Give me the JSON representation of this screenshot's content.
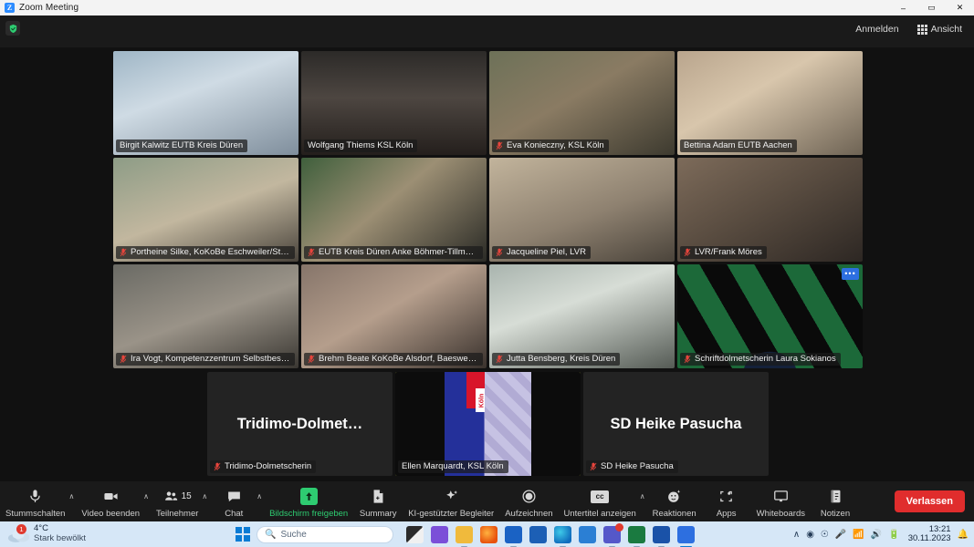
{
  "window": {
    "title": "Zoom Meeting",
    "logo_text": "Z",
    "minimize": "–",
    "maximize": "▭",
    "close": "✕"
  },
  "header": {
    "shield_icon": "security-shield-icon",
    "sign_in_label": "Anmelden",
    "view_label": "Ansicht"
  },
  "gallery": {
    "tiles": [
      {
        "name": "Birgit Kalwitz EUTB Kreis Düren",
        "muted": false,
        "speaking": false,
        "more": false,
        "bg": "linear-gradient(160deg,#9fb6c6 0%,#cfdbe4 40%,#7f8e9c 100%)"
      },
      {
        "name": "Wolfgang Thiems KSL Köln",
        "muted": false,
        "speaking": false,
        "more": false,
        "bg": "linear-gradient(180deg,#2c2a28 0%,#4d4641 45%,#241f1c 100%)"
      },
      {
        "name": "Eva Konieczny, KSL Köln",
        "muted": true,
        "speaking": false,
        "more": false,
        "bg": "linear-gradient(150deg,#6d7158 0%,#8a7b63 45%,#3d3a2f 100%)"
      },
      {
        "name": "Bettina Adam EUTB Aachen",
        "muted": false,
        "speaking": false,
        "more": false,
        "bg": "linear-gradient(150deg,#b9a58d 0%,#d8c6ac 40%,#6e6354 100%)"
      },
      {
        "name": "Portheine Silke, KoKoBe Eschweiler/Stolberg",
        "muted": true,
        "speaking": false,
        "more": false,
        "bg": "linear-gradient(160deg,#8d9c86 0%,#c2b79f 50%,#4a443c 100%)"
      },
      {
        "name": "EUTB Kreis Düren Anke Böhmer-Tillmann",
        "muted": true,
        "speaking": false,
        "more": false,
        "bg": "linear-gradient(140deg,#3f5f3c 0%,#9c8f74 45%,#2b2b26 100%)"
      },
      {
        "name": "Jacqueline Piel, LVR",
        "muted": true,
        "speaking": false,
        "more": false,
        "bg": "linear-gradient(160deg,#c2b49c 0%,#8e8170 55%,#4b443b 100%)"
      },
      {
        "name": "LVR/Frank Möres",
        "muted": true,
        "speaking": false,
        "more": false,
        "bg": "linear-gradient(150deg,#7d6b5a 0%,#5a4d41 45%,#2d2723 100%)"
      },
      {
        "name": "Ira Vogt, Kompetenzzentrum Selbstbestimmt …",
        "muted": true,
        "speaking": false,
        "more": false,
        "bg": "linear-gradient(160deg,#6a6a64 0%,#9a9388 50%,#3a3732 100%)"
      },
      {
        "name": "Brehm Beate KoKoBe Alsdorf, Baesweiler, Herz…",
        "muted": true,
        "speaking": false,
        "more": false,
        "bg": "linear-gradient(150deg,#86756a 0%,#b59e8c 45%,#3a322d 100%)"
      },
      {
        "name": "Jutta Bensberg, Kreis Düren",
        "muted": true,
        "speaking": false,
        "more": false,
        "bg": "linear-gradient(160deg,#a9b4ae 0%,#d7ddd6 40%,#555b55 100%)"
      },
      {
        "name": "Schriftdolmetscherin Laura Sokianos",
        "muted": true,
        "speaking": false,
        "more": true,
        "bg": "#0a0a0a"
      }
    ],
    "bottom_tiles": [
      {
        "name": "Tridimo-Dolmetscherin",
        "display_name": "Tridimo-Dolmet…",
        "muted": true,
        "speaking": false,
        "video_off": true
      },
      {
        "name": "Ellen Marquardt, KSL Köln",
        "display_name": "",
        "muted": false,
        "speaking": true,
        "video_off": false
      },
      {
        "name": "SD Heike Pasucha",
        "display_name": "SD Heike Pasucha",
        "muted": true,
        "speaking": false,
        "video_off": true
      }
    ],
    "speaking_border_color": "#d6e84b",
    "more_button_label": "•••"
  },
  "toolbar": {
    "items": [
      {
        "label": "Stummschalten",
        "icon": "microphone-icon",
        "caret": true,
        "badge": ""
      },
      {
        "label": "Video beenden",
        "icon": "camera-icon",
        "caret": true,
        "badge": ""
      },
      {
        "label": "Teilnehmer",
        "icon": "participants-icon",
        "caret": true,
        "badge": "15"
      },
      {
        "label": "Chat",
        "icon": "chat-bubble-icon",
        "caret": true,
        "badge": ""
      },
      {
        "label": "Bildschirm freigeben",
        "icon": "share-screen-icon",
        "caret": false,
        "badge": ""
      },
      {
        "label": "Summary",
        "icon": "summary-document-icon",
        "caret": false,
        "badge": ""
      },
      {
        "label": "KI-gestützter Begleiter",
        "icon": "ai-sparkle-icon",
        "caret": false,
        "badge": ""
      },
      {
        "label": "Aufzeichnen",
        "icon": "record-circle-icon",
        "caret": false,
        "badge": ""
      },
      {
        "label": "Untertitel anzeigen",
        "icon": "closed-caption-icon",
        "caret": true,
        "badge": ""
      },
      {
        "label": "Reaktionen",
        "icon": "reactions-smiley-icon",
        "caret": false,
        "badge": ""
      },
      {
        "label": "Apps",
        "icon": "apps-icon",
        "caret": false,
        "badge": ""
      },
      {
        "label": "Whiteboards",
        "icon": "whiteboard-icon",
        "caret": false,
        "badge": ""
      },
      {
        "label": "Notizen",
        "icon": "notes-icon",
        "caret": false,
        "badge": ""
      }
    ],
    "leave_label": "Verlassen",
    "share_color": "#2ecc71",
    "leave_color": "#e02d2d"
  },
  "taskbar": {
    "weather": {
      "temperature": "4°C",
      "condition": "Stark bewölkt",
      "badge": "1",
      "icon": "cloud-icon"
    },
    "start_icon": "windows-start-icon",
    "search_placeholder": "Suche",
    "search_icon": "search-icon",
    "apps": [
      "task-view-icon",
      "zoom-app-icon",
      "file-explorer-icon",
      "firefox-icon",
      "outlook-icon",
      "microsoft-store-icon",
      "edge-icon",
      "todo-check-icon",
      "teams-icon",
      "excel-icon",
      "word-icon",
      "zoom-meeting-active-icon"
    ],
    "tray": {
      "chevron": "∧",
      "icons": [
        "sync-icon",
        "mouse-icon",
        "microphone-tray-icon",
        "wifi-icon",
        "volume-icon",
        "battery-icon"
      ],
      "time": "13:21",
      "date": "30.11.2023",
      "notification_icon": "bell-icon"
    }
  }
}
